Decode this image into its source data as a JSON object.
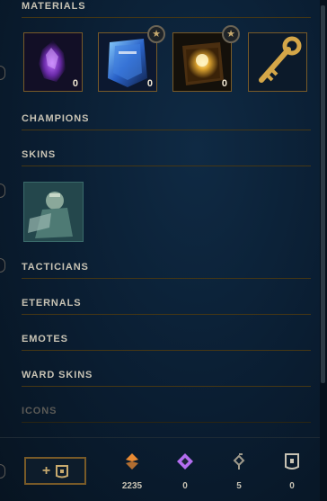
{
  "sections": {
    "materials": "MATERIALS",
    "champions": "CHAMPIONS",
    "skins": "SKINS",
    "tacticians": "TACTICIANS",
    "eternals": "ETERNALS",
    "emotes": "EMOTES",
    "ward_skins": "WARD SKINS",
    "icons": "ICONS"
  },
  "materials": [
    {
      "icon": "purple-crystal-icon",
      "count": "0",
      "star": false
    },
    {
      "icon": "blue-chest-icon",
      "count": "0",
      "star": true
    },
    {
      "icon": "hextech-chest-icon",
      "count": "0",
      "star": true
    },
    {
      "icon": "key-icon",
      "count": "",
      "star": false
    }
  ],
  "footer": {
    "add_button_label": "+",
    "currencies": [
      {
        "icon": "blue-essence-icon",
        "value": "2235",
        "color": "#e88a33"
      },
      {
        "icon": "mythic-essence-icon",
        "value": "0",
        "color": "#b46ef0"
      },
      {
        "icon": "key-fragment-icon",
        "value": "5",
        "color": "#a09b8c"
      },
      {
        "icon": "chest-icon",
        "value": "0",
        "color": "#c8c3b4"
      }
    ]
  },
  "colors": {
    "gold": "#785a28",
    "text": "#c8c3b4",
    "background": "#0a1d31"
  }
}
